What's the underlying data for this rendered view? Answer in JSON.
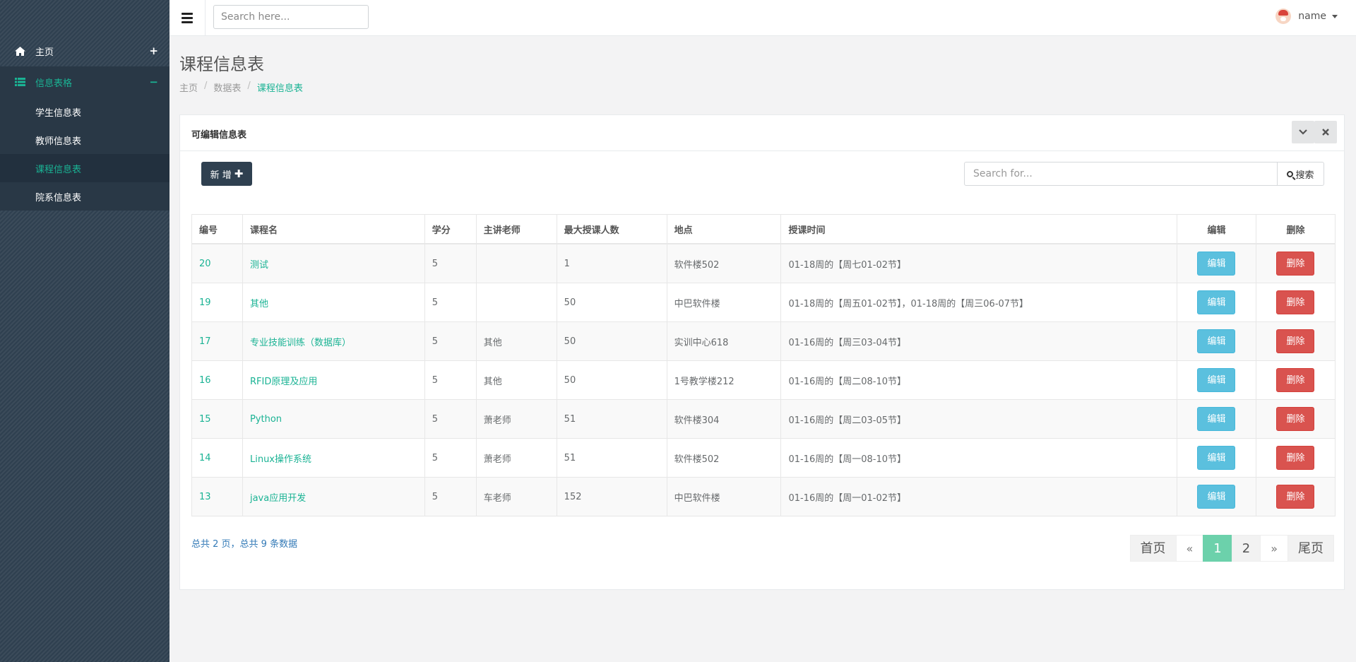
{
  "sidebar": {
    "items": [
      {
        "label": "主页",
        "icon": "home-icon",
        "sign": "+"
      },
      {
        "label": "信息表格",
        "icon": "table-icon",
        "sign": "−"
      }
    ],
    "subitems": [
      {
        "label": "学生信息表"
      },
      {
        "label": "教师信息表"
      },
      {
        "label": "课程信息表"
      },
      {
        "label": "院系信息表"
      }
    ]
  },
  "topbar": {
    "search_placeholder": "Search here...",
    "username": "name"
  },
  "page": {
    "title": "课程信息表",
    "breadcrumb": [
      "主页",
      "数据表",
      "课程信息表"
    ],
    "breadcrumb_sep": "/"
  },
  "panel": {
    "title": "可编辑信息表",
    "add_label": "新 增",
    "search_placeholder": "Search for...",
    "search_button": "搜索"
  },
  "table": {
    "headers": [
      "编号",
      "课程名",
      "学分",
      "主讲老师",
      "最大授课人数",
      "地点",
      "授课时间",
      "编辑",
      "删除"
    ],
    "rows": [
      {
        "id": "20",
        "name": "测试",
        "credit": "5",
        "teacher": "",
        "max": "1",
        "place": "软件楼502",
        "time": "01-18周的【周七01-02节】",
        "edit": "编辑",
        "del": "删除"
      },
      {
        "id": "19",
        "name": "其他",
        "credit": "5",
        "teacher": "",
        "max": "50",
        "place": "中巴软件楼",
        "time": "01-18周的【周五01-02节】，01-18周的【周三06-07节】",
        "edit": "编辑",
        "del": "删除"
      },
      {
        "id": "17",
        "name": "专业技能训练（数据库）",
        "credit": "5",
        "teacher": "其他",
        "max": "50",
        "place": "实训中心618",
        "time": "01-16周的【周三03-04节】",
        "edit": "编辑",
        "del": "删除"
      },
      {
        "id": "16",
        "name": "RFID原理及应用",
        "credit": "5",
        "teacher": "其他",
        "max": "50",
        "place": "1号教学楼212",
        "time": "01-16周的【周二08-10节】",
        "edit": "编辑",
        "del": "删除"
      },
      {
        "id": "15",
        "name": "Python",
        "credit": "5",
        "teacher": "萧老师",
        "max": "51",
        "place": "软件楼304",
        "time": "01-16周的【周二03-05节】",
        "edit": "编辑",
        "del": "删除"
      },
      {
        "id": "14",
        "name": "Linux操作系统",
        "credit": "5",
        "teacher": "萧老师",
        "max": "51",
        "place": "软件楼502",
        "time": "01-16周的【周一08-10节】",
        "edit": "编辑",
        "del": "删除"
      },
      {
        "id": "13",
        "name": "java应用开发",
        "credit": "5",
        "teacher": "车老师",
        "max": "152",
        "place": "中巴软件楼",
        "time": "01-16周的【周一01-02节】",
        "edit": "编辑",
        "del": "删除"
      }
    ]
  },
  "footer": {
    "summary": "总共 2 页，总共 9 条数据",
    "pager": {
      "first": "首页",
      "prev": "«",
      "pages": [
        "1",
        "2"
      ],
      "current": "1",
      "next": "»",
      "last": "尾页"
    }
  },
  "colors": {
    "accent": "#1ab394",
    "sidebar": "#2f4050",
    "edit": "#5bc0de",
    "delete": "#d9534f"
  }
}
